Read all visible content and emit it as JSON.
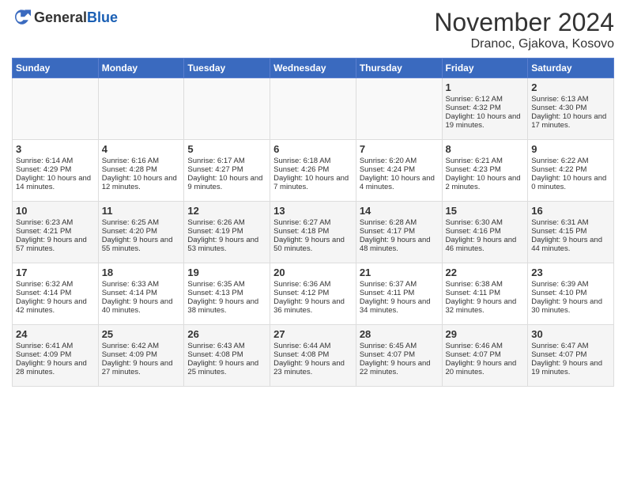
{
  "header": {
    "logo_general": "General",
    "logo_blue": "Blue",
    "title": "November 2024",
    "location": "Dranoc, Gjakova, Kosovo"
  },
  "days_of_week": [
    "Sunday",
    "Monday",
    "Tuesday",
    "Wednesday",
    "Thursday",
    "Friday",
    "Saturday"
  ],
  "weeks": [
    {
      "days": [
        {
          "num": "",
          "content": ""
        },
        {
          "num": "",
          "content": ""
        },
        {
          "num": "",
          "content": ""
        },
        {
          "num": "",
          "content": ""
        },
        {
          "num": "",
          "content": ""
        },
        {
          "num": "1",
          "content": "Sunrise: 6:12 AM\nSunset: 4:32 PM\nDaylight: 10 hours and 19 minutes."
        },
        {
          "num": "2",
          "content": "Sunrise: 6:13 AM\nSunset: 4:30 PM\nDaylight: 10 hours and 17 minutes."
        }
      ]
    },
    {
      "days": [
        {
          "num": "3",
          "content": "Sunrise: 6:14 AM\nSunset: 4:29 PM\nDaylight: 10 hours and 14 minutes."
        },
        {
          "num": "4",
          "content": "Sunrise: 6:16 AM\nSunset: 4:28 PM\nDaylight: 10 hours and 12 minutes."
        },
        {
          "num": "5",
          "content": "Sunrise: 6:17 AM\nSunset: 4:27 PM\nDaylight: 10 hours and 9 minutes."
        },
        {
          "num": "6",
          "content": "Sunrise: 6:18 AM\nSunset: 4:26 PM\nDaylight: 10 hours and 7 minutes."
        },
        {
          "num": "7",
          "content": "Sunrise: 6:20 AM\nSunset: 4:24 PM\nDaylight: 10 hours and 4 minutes."
        },
        {
          "num": "8",
          "content": "Sunrise: 6:21 AM\nSunset: 4:23 PM\nDaylight: 10 hours and 2 minutes."
        },
        {
          "num": "9",
          "content": "Sunrise: 6:22 AM\nSunset: 4:22 PM\nDaylight: 10 hours and 0 minutes."
        }
      ]
    },
    {
      "days": [
        {
          "num": "10",
          "content": "Sunrise: 6:23 AM\nSunset: 4:21 PM\nDaylight: 9 hours and 57 minutes."
        },
        {
          "num": "11",
          "content": "Sunrise: 6:25 AM\nSunset: 4:20 PM\nDaylight: 9 hours and 55 minutes."
        },
        {
          "num": "12",
          "content": "Sunrise: 6:26 AM\nSunset: 4:19 PM\nDaylight: 9 hours and 53 minutes."
        },
        {
          "num": "13",
          "content": "Sunrise: 6:27 AM\nSunset: 4:18 PM\nDaylight: 9 hours and 50 minutes."
        },
        {
          "num": "14",
          "content": "Sunrise: 6:28 AM\nSunset: 4:17 PM\nDaylight: 9 hours and 48 minutes."
        },
        {
          "num": "15",
          "content": "Sunrise: 6:30 AM\nSunset: 4:16 PM\nDaylight: 9 hours and 46 minutes."
        },
        {
          "num": "16",
          "content": "Sunrise: 6:31 AM\nSunset: 4:15 PM\nDaylight: 9 hours and 44 minutes."
        }
      ]
    },
    {
      "days": [
        {
          "num": "17",
          "content": "Sunrise: 6:32 AM\nSunset: 4:14 PM\nDaylight: 9 hours and 42 minutes."
        },
        {
          "num": "18",
          "content": "Sunrise: 6:33 AM\nSunset: 4:14 PM\nDaylight: 9 hours and 40 minutes."
        },
        {
          "num": "19",
          "content": "Sunrise: 6:35 AM\nSunset: 4:13 PM\nDaylight: 9 hours and 38 minutes."
        },
        {
          "num": "20",
          "content": "Sunrise: 6:36 AM\nSunset: 4:12 PM\nDaylight: 9 hours and 36 minutes."
        },
        {
          "num": "21",
          "content": "Sunrise: 6:37 AM\nSunset: 4:11 PM\nDaylight: 9 hours and 34 minutes."
        },
        {
          "num": "22",
          "content": "Sunrise: 6:38 AM\nSunset: 4:11 PM\nDaylight: 9 hours and 32 minutes."
        },
        {
          "num": "23",
          "content": "Sunrise: 6:39 AM\nSunset: 4:10 PM\nDaylight: 9 hours and 30 minutes."
        }
      ]
    },
    {
      "days": [
        {
          "num": "24",
          "content": "Sunrise: 6:41 AM\nSunset: 4:09 PM\nDaylight: 9 hours and 28 minutes."
        },
        {
          "num": "25",
          "content": "Sunrise: 6:42 AM\nSunset: 4:09 PM\nDaylight: 9 hours and 27 minutes."
        },
        {
          "num": "26",
          "content": "Sunrise: 6:43 AM\nSunset: 4:08 PM\nDaylight: 9 hours and 25 minutes."
        },
        {
          "num": "27",
          "content": "Sunrise: 6:44 AM\nSunset: 4:08 PM\nDaylight: 9 hours and 23 minutes."
        },
        {
          "num": "28",
          "content": "Sunrise: 6:45 AM\nSunset: 4:07 PM\nDaylight: 9 hours and 22 minutes."
        },
        {
          "num": "29",
          "content": "Sunrise: 6:46 AM\nSunset: 4:07 PM\nDaylight: 9 hours and 20 minutes."
        },
        {
          "num": "30",
          "content": "Sunrise: 6:47 AM\nSunset: 4:07 PM\nDaylight: 9 hours and 19 minutes."
        }
      ]
    }
  ]
}
